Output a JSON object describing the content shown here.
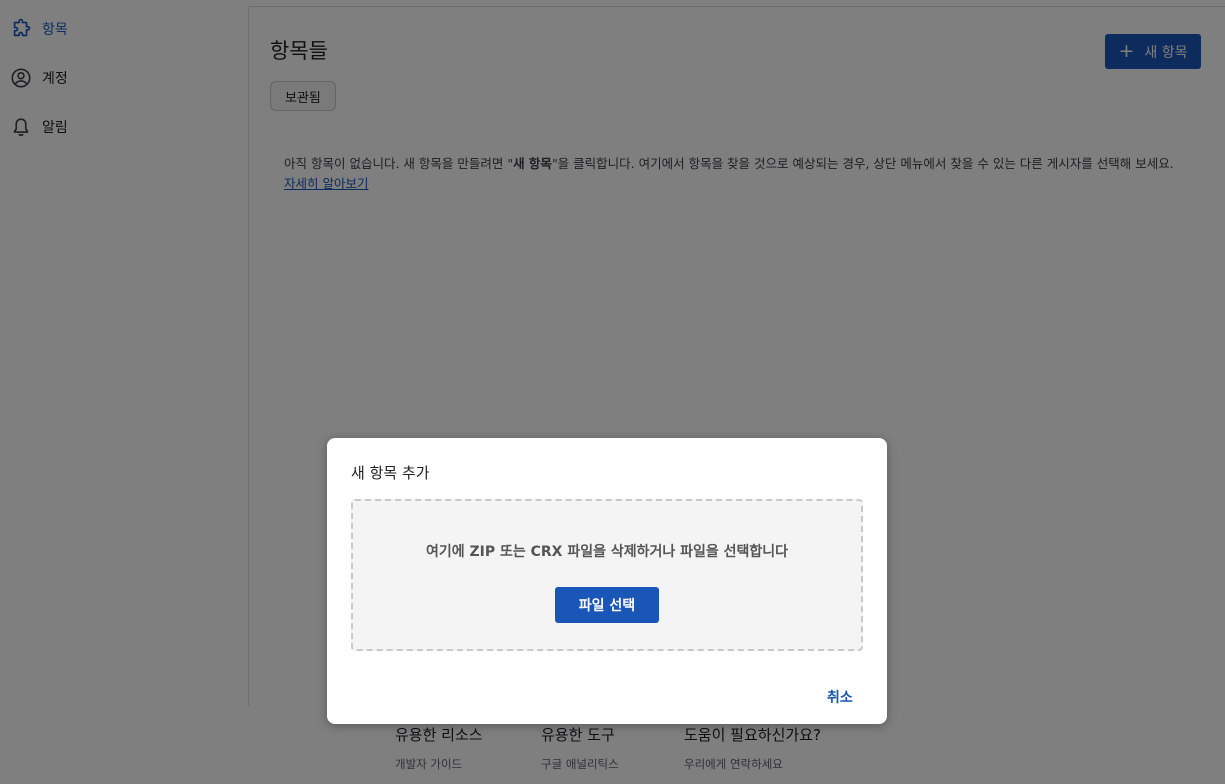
{
  "sidebar": {
    "items": [
      {
        "label": "항목",
        "icon": "puzzle-icon",
        "active": true
      },
      {
        "label": "계정",
        "icon": "account-circle-icon",
        "active": false
      },
      {
        "label": "알림",
        "icon": "bell-icon",
        "active": false
      }
    ]
  },
  "main": {
    "title": "항목들",
    "archived_label": "보관됨",
    "new_item_label": "새 항목",
    "empty_message_before": "아직 항목이 없습니다. 새 항목을 만들려면 \"",
    "empty_message_bold": "새 항목",
    "empty_message_after": "\"을 클릭합니다. 여기에서 항목을 찾을 것으로 예상되는 경우, 상단 메뉴에서 찾을 수 있는 다른 게시자를 선택해 보세요.",
    "learn_more_link": "자세히 알아보기"
  },
  "footer": {
    "columns": [
      {
        "heading": "유용한 리소스",
        "link": "개발자 가이드"
      },
      {
        "heading": "유용한 도구",
        "link": "구글 애널리틱스"
      },
      {
        "heading": "도움이 필요하신가요?",
        "link": "우리에게 연락하세요"
      }
    ]
  },
  "dialog": {
    "title": "새 항목 추가",
    "drop_text": "여기에 ZIP 또는 CRX 파일을 삭제하거나 파일을 선택합니다",
    "choose_file_label": "파일 선택",
    "cancel_label": "취소"
  },
  "colors": {
    "accent": "#1a56b8",
    "overlay": "rgba(0,0,0,0.5)"
  }
}
